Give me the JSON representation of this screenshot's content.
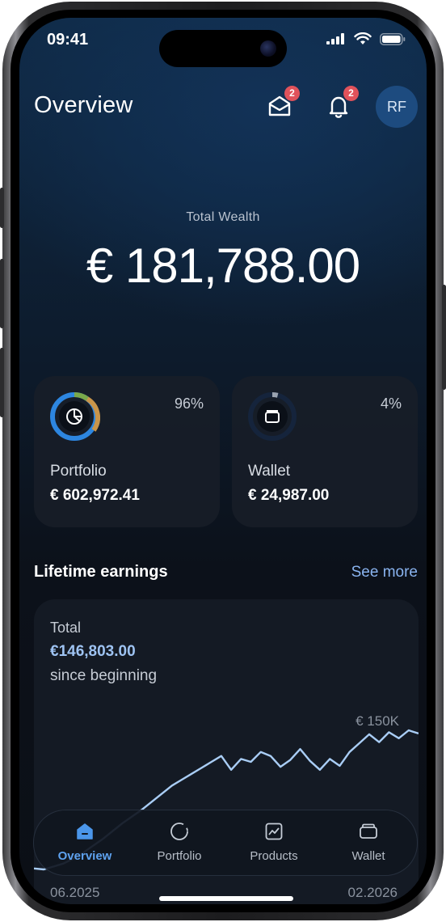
{
  "status": {
    "time": "09:41"
  },
  "header": {
    "title": "Overview",
    "messages_badge": "2",
    "notifications_badge": "2",
    "avatar_initials": "RF"
  },
  "total_wealth": {
    "label": "Total Wealth",
    "value": "€ 181,788.00"
  },
  "cards": [
    {
      "name": "Portfolio",
      "value": "€ 602,972.41",
      "percent": "96%",
      "icon": "pie-chart-icon"
    },
    {
      "name": "Wallet",
      "value": "€ 24,987.00",
      "percent": "4%",
      "icon": "wallet-icon"
    }
  ],
  "lifetime": {
    "title": "Lifetime earnings",
    "see_more": "See more",
    "total_label": "Total",
    "total_value": "€146,803.00",
    "since": "since beginning"
  },
  "tabs": [
    {
      "label": "Overview",
      "icon": "home-icon",
      "active": true
    },
    {
      "label": "Portfolio",
      "icon": "pie-icon",
      "active": false
    },
    {
      "label": "Products",
      "icon": "chart-icon",
      "active": false
    },
    {
      "label": "Wallet",
      "icon": "wallet-icon",
      "active": false
    }
  ],
  "chart_data": {
    "type": "line",
    "y_tick_label": "€ 150K",
    "x_tick_labels": [
      "06.2025",
      "02.2026"
    ],
    "x": [
      "06.2025",
      "02.2026"
    ],
    "series": [
      {
        "values": [
          10000,
          9000,
          12000,
          15000,
          20000,
          26000,
          33000,
          40000,
          48000,
          56000,
          63000,
          70000,
          78000,
          86000,
          94000,
          100000,
          106000,
          112000,
          118000,
          124000,
          110000,
          121000,
          118000,
          128000,
          124000,
          113000,
          120000,
          131000,
          119000,
          110000,
          121000,
          114000,
          128000,
          137000,
          146000,
          138000,
          148000,
          142000,
          150000,
          146803
        ]
      }
    ],
    "colors": {
      "line": "#a9cdf5"
    }
  }
}
